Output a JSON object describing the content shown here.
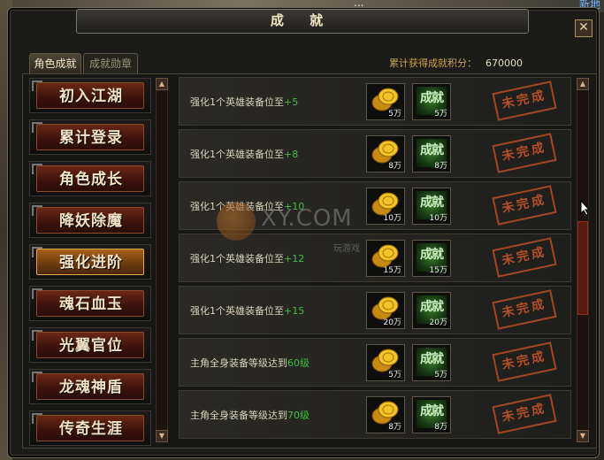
{
  "background": {
    "left_text": "...",
    "right_text": "新地"
  },
  "window": {
    "title": "成 就",
    "close_symbol": "✕"
  },
  "tabs": [
    {
      "label": "角色成就",
      "active": true
    },
    {
      "label": "成就勋章",
      "active": false
    }
  ],
  "points": {
    "label": "累计获得成就积分：",
    "value": "670000"
  },
  "sidebar": {
    "items": [
      {
        "label": "初入江湖"
      },
      {
        "label": "累计登录"
      },
      {
        "label": "角色成长"
      },
      {
        "label": "降妖除魔"
      },
      {
        "label": "强化进阶",
        "selected": true
      },
      {
        "label": "魂石血玉"
      },
      {
        "label": "光翼官位"
      },
      {
        "label": "龙魂神盾"
      },
      {
        "label": "传奇生涯"
      }
    ]
  },
  "achievements": [
    {
      "prefix": "强化1个英雄装备位至",
      "value": "+5",
      "gold": "5万",
      "badge_label": "成就",
      "badge_qty": "5万",
      "status": "未完成"
    },
    {
      "prefix": "强化1个英雄装备位至",
      "value": "+8",
      "gold": "8万",
      "badge_label": "成就",
      "badge_qty": "8万",
      "status": "未完成"
    },
    {
      "prefix": "强化1个英雄装备位至",
      "value": "+10",
      "gold": "10万",
      "badge_label": "成就",
      "badge_qty": "10万",
      "status": "未完成"
    },
    {
      "prefix": "强化1个英雄装备位至",
      "value": "+12",
      "gold": "15万",
      "badge_label": "成就",
      "badge_qty": "15万",
      "status": "未完成"
    },
    {
      "prefix": "强化1个英雄装备位至",
      "value": "+15",
      "gold": "20万",
      "badge_label": "成就",
      "badge_qty": "20万",
      "status": "未完成"
    },
    {
      "prefix": "主角全身装备等级达到",
      "value": "60级",
      "gold": "5万",
      "badge_label": "成就",
      "badge_qty": "5万",
      "status": "未完成"
    },
    {
      "prefix": "主角全身装备等级达到",
      "value": "70级",
      "gold": "8万",
      "badge_label": "成就",
      "badge_qty": "8万",
      "status": "未完成"
    }
  ],
  "watermark": {
    "text": "XY.COM",
    "sub": "玩游戏"
  },
  "colors": {
    "accent_gold": "#c9a44b",
    "stamp_red": "#c4542a",
    "value_green": "#3fbf3f"
  },
  "icons": {
    "close": "close-icon",
    "scroll_up": "triangle-up-icon",
    "scroll_down": "triangle-down-icon",
    "coin": "gold-coin-icon",
    "badge": "achievement-badge-icon"
  }
}
